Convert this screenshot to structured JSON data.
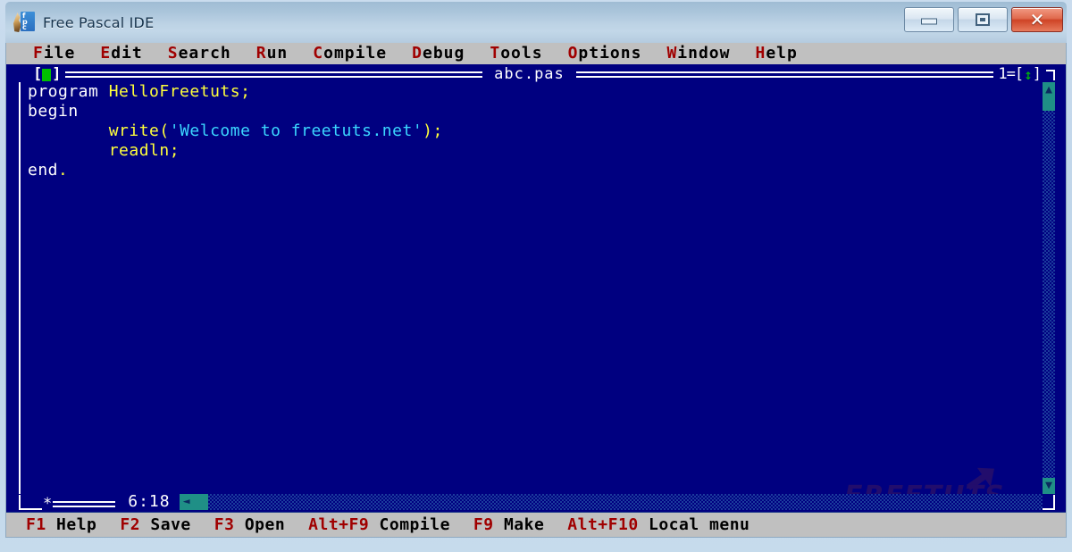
{
  "window": {
    "title": "Free Pascal IDE",
    "icon": "fpc-logo-icon",
    "buttons": {
      "minimize": "minimize-icon",
      "maximize": "maximize-icon",
      "close": "✕"
    }
  },
  "menubar": {
    "items": [
      {
        "hot": "F",
        "rest": "ile"
      },
      {
        "hot": "E",
        "rest": "dit"
      },
      {
        "hot": "S",
        "rest": "earch"
      },
      {
        "hot": "R",
        "rest": "un"
      },
      {
        "hot": "C",
        "rest": "ompile"
      },
      {
        "hot": "D",
        "rest": "ebug"
      },
      {
        "hot": "T",
        "rest": "ools"
      },
      {
        "hot": "O",
        "rest": "ptions"
      },
      {
        "hot": "W",
        "rest": "indow"
      },
      {
        "hot": "H",
        "rest": "elp"
      }
    ]
  },
  "editor": {
    "title": "abc.pas",
    "close_box_left": "[",
    "close_box_right": "]",
    "window_number": "1=[",
    "window_number_end": "]",
    "zoom_box": "↕",
    "modified_mark": "*",
    "cursor_position": "6:18",
    "scrollbar": {
      "up_arrow": "▲",
      "down_arrow": "▼",
      "left_arrow": "◄",
      "right_arrow": "►"
    },
    "code_lines": [
      [
        {
          "t": "program ",
          "c": "kw"
        },
        {
          "t": "HelloFreetuts;",
          "c": "id"
        }
      ],
      [
        {
          "t": "begin",
          "c": "kw"
        }
      ],
      [
        {
          "t": "        ",
          "c": "wht"
        },
        {
          "t": "write(",
          "c": "id"
        },
        {
          "t": "'Welcome to freetuts.net'",
          "c": "str"
        },
        {
          "t": ");",
          "c": "pun"
        }
      ],
      [
        {
          "t": "        ",
          "c": "wht"
        },
        {
          "t": "readln;",
          "c": "id"
        }
      ],
      [
        {
          "t": "end",
          "c": "kw"
        },
        {
          "t": ".",
          "c": "pun"
        }
      ]
    ]
  },
  "watermark": {
    "text": "FREETUTS"
  },
  "statusbar": {
    "items": [
      {
        "key": "F1",
        "label": "Help"
      },
      {
        "key": "F2",
        "label": "Save"
      },
      {
        "key": "F3",
        "label": "Open"
      },
      {
        "key": "Alt+F9",
        "label": "Compile"
      },
      {
        "key": "F9",
        "label": "Make"
      },
      {
        "key": "Alt+F10",
        "label": "Local menu"
      }
    ]
  },
  "colors": {
    "editor_background": "#000080",
    "menubar_background": "#c0c0c0",
    "keyword": "#ffffff",
    "identifier": "#ffff3b",
    "string": "#3bd7ff",
    "hotkey": "#a00000",
    "scrollbar": "#1f8f86",
    "close_box_green": "#00c000"
  }
}
